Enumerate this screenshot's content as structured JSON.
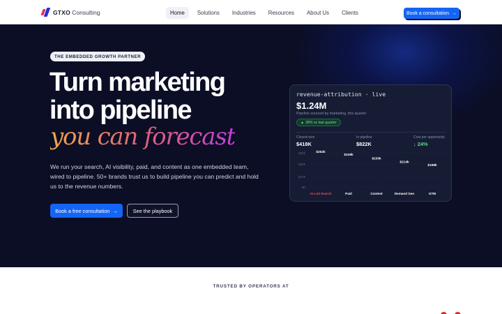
{
  "brand": {
    "name_bold": "GTXO",
    "name_rest": " Consulting"
  },
  "nav": {
    "items": [
      {
        "label": "Home",
        "active": true
      },
      {
        "label": "Solutions",
        "active": false
      },
      {
        "label": "Industries",
        "active": false
      },
      {
        "label": "Resources",
        "active": false
      },
      {
        "label": "About Us",
        "active": false
      },
      {
        "label": "Clients",
        "active": false
      }
    ],
    "cta_label": "Book a consultation",
    "cta_arrow": "→"
  },
  "hero": {
    "eyebrow": "THE EMBEDDED GROWTH PARTNER",
    "headline_line1": "Turn marketing",
    "headline_line2": "into pipeline",
    "headline_accent": "you can forecast",
    "subtext": "We run your search, AI visibility, paid, and content as one embedded team, wired to pipeline. 50+ brands trust us to build pipeline you can predict and hold us to the revenue numbers.",
    "primary_cta": "Book a free consultation",
    "primary_arrow": "→",
    "secondary_cta": "See the playbook"
  },
  "card": {
    "title": "revenue-attribution · live",
    "value": "$1.24M",
    "caption": "Pipeline sourced by marketing, this quarter",
    "badge": "38% vs last quarter",
    "badge_icon": "▲",
    "stats": [
      {
        "label": "Closed-won",
        "value": "$418K",
        "tone": "white"
      },
      {
        "label": "In pipeline",
        "value": "$822K",
        "tone": "white"
      },
      {
        "label": "Cost per opportunity",
        "value": "↓ 24%",
        "tone": "green"
      }
    ]
  },
  "chart_data": {
    "type": "bar",
    "categories": [
      "AI-Led Search",
      "Paid",
      "Content",
      "Demand Gen",
      "GTM"
    ],
    "values": [
      262,
      249,
      230,
      214,
      198
    ],
    "value_labels": [
      "$262k",
      "$249k",
      "$230k",
      "$214k",
      "$198k"
    ],
    "highlight_category": "AI-Led Search",
    "y_ticks": [
      "$0",
      "$10k",
      "$20k",
      "$30k"
    ],
    "colors": {
      "highlight_label": "#e8505b",
      "label": "#ffffff",
      "tick": "#5d6584",
      "grid": "#232a45"
    }
  },
  "trusted": {
    "label": "TRUSTED BY OPERATORS AT"
  }
}
